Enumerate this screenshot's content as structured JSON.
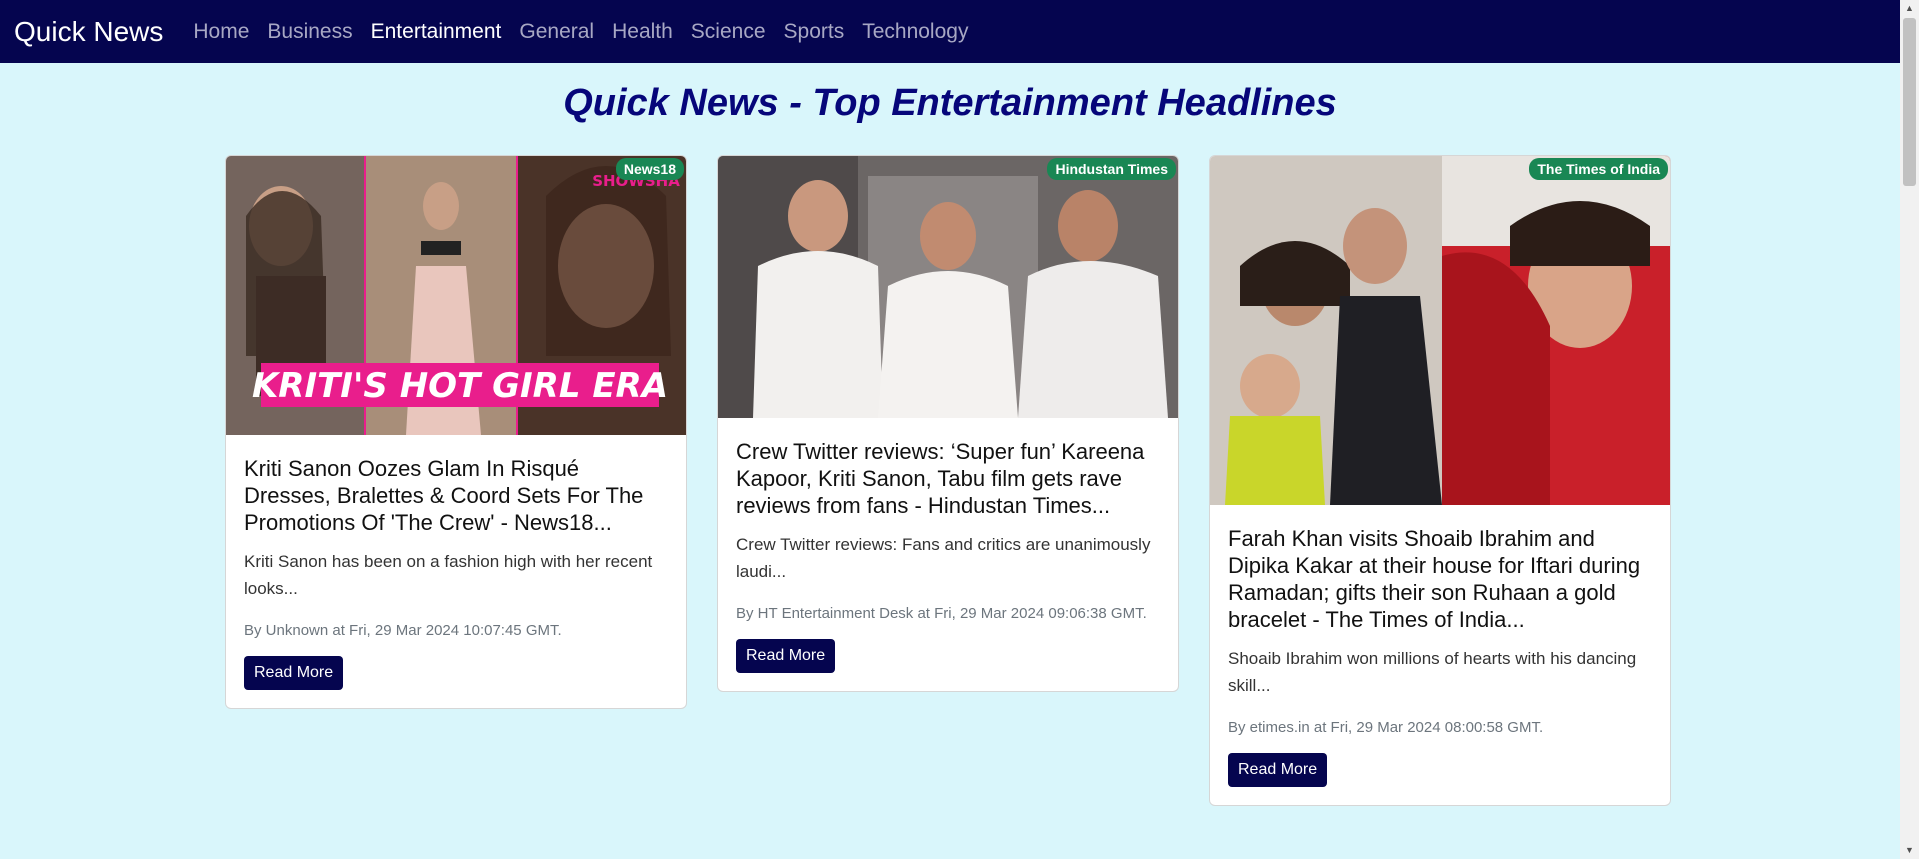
{
  "nav": {
    "brand": "Quick News",
    "links": [
      "Home",
      "Business",
      "Entertainment",
      "General",
      "Health",
      "Science",
      "Sports",
      "Technology"
    ],
    "active": "Entertainment"
  },
  "heading": "Quick News - Top Entertainment Headlines",
  "articles": [
    {
      "source": "News18",
      "image_text": "KRITI'S HOT GIRL ERA",
      "image_logo": "SHOWSHA",
      "title": "Kriti Sanon Oozes Glam In Risqué Dresses, Bralettes & Coord Sets For The Promotions Of 'The Crew' - News18...",
      "description": "Kriti Sanon has been on a fashion high with her recent looks...",
      "meta": "By Unknown at Fri, 29 Mar 2024 10:07:45 GMT.",
      "button": "Read More"
    },
    {
      "source": "Hindustan Times",
      "title": "Crew Twitter reviews: ‘Super fun’ Kareena Kapoor, Kriti Sanon, Tabu film gets rave reviews from fans - Hindustan Times...",
      "description": "Crew Twitter reviews: Fans and critics are unanimously laudi...",
      "meta": "By HT Entertainment Desk at Fri, 29 Mar 2024 09:06:38 GMT.",
      "button": "Read More"
    },
    {
      "source": "The Times of India",
      "title": "Farah Khan visits Shoaib Ibrahim and Dipika Kakar at their house for Iftari during Ramadan; gifts their son Ruhaan a gold bracelet - The Times of India...",
      "description": "Shoaib Ibrahim won millions of hearts with his dancing skill...",
      "meta": "By etimes.in at Fri, 29 Mar 2024 08:00:58 GMT.",
      "button": "Read More"
    }
  ],
  "colors": {
    "navbar": "#05054f",
    "page_background": "#d9f6fb",
    "heading": "#06067a",
    "badge": "#198754",
    "button": "#05054f"
  }
}
